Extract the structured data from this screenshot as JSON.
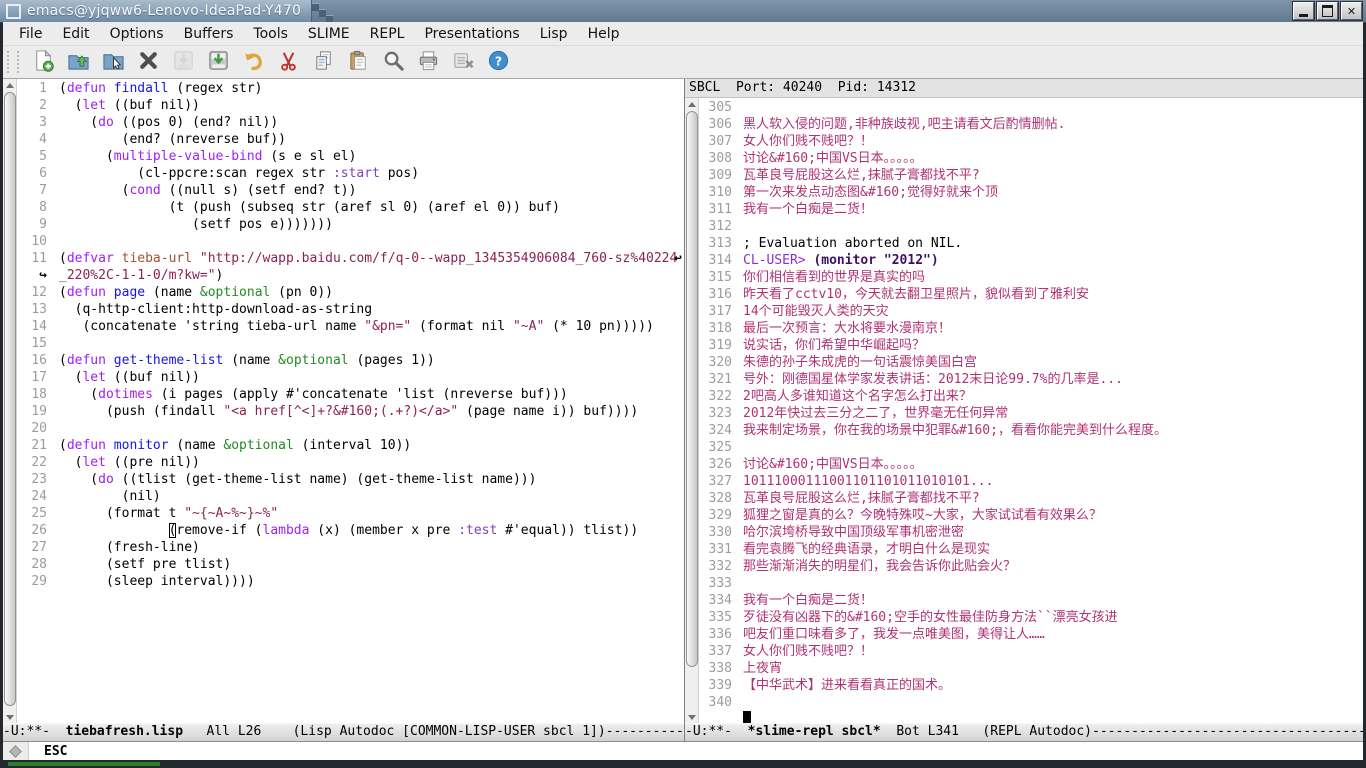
{
  "window": {
    "title": "emacs@yjqww6-Lenovo-IdeaPad-Y470",
    "buttons": [
      "minimize",
      "maximize",
      "close"
    ],
    "close_glyph": "✕"
  },
  "menu": {
    "items": [
      "File",
      "Edit",
      "Options",
      "Buffers",
      "Tools",
      "SLIME",
      "REPL",
      "Presentations",
      "Lisp",
      "Help"
    ]
  },
  "toolbar": {
    "buttons": [
      {
        "name": "new-file",
        "disabled": false
      },
      {
        "name": "open-file",
        "disabled": false
      },
      {
        "name": "dired",
        "disabled": false
      },
      {
        "name": "close-buffer",
        "disabled": false
      },
      {
        "name": "save",
        "disabled": true
      },
      {
        "name": "save-as",
        "disabled": false
      },
      {
        "name": "undo",
        "disabled": false
      },
      {
        "name": "cut",
        "disabled": false
      },
      {
        "name": "copy",
        "disabled": false
      },
      {
        "name": "paste",
        "disabled": false
      },
      {
        "name": "search",
        "disabled": false
      },
      {
        "name": "print",
        "disabled": false
      },
      {
        "name": "customize",
        "disabled": false
      },
      {
        "name": "help",
        "disabled": false
      }
    ]
  },
  "left_window": {
    "rows": [
      {
        "n": "1",
        "seg": [
          [
            "d",
            "("
          ],
          [
            "k",
            "defun"
          ],
          [
            "d",
            " "
          ],
          [
            "f",
            "findall"
          ],
          [
            "d",
            " (regex str)"
          ]
        ]
      },
      {
        "n": "2",
        "seg": [
          [
            "d",
            "  ("
          ],
          [
            "k",
            "let"
          ],
          [
            "d",
            " ((buf nil))"
          ]
        ]
      },
      {
        "n": "3",
        "seg": [
          [
            "d",
            "    ("
          ],
          [
            "k",
            "do"
          ],
          [
            "d",
            " ((pos 0) (end? nil))"
          ]
        ]
      },
      {
        "n": "4",
        "seg": [
          [
            "d",
            "        (end? (nreverse buf))"
          ]
        ]
      },
      {
        "n": "5",
        "seg": [
          [
            "d",
            "      ("
          ],
          [
            "k",
            "multiple-value-bind"
          ],
          [
            "d",
            " (s e sl el)"
          ]
        ]
      },
      {
        "n": "6",
        "seg": [
          [
            "d",
            "          (cl-ppcre:scan regex str "
          ],
          [
            "b",
            ":start"
          ],
          [
            "d",
            " pos)"
          ]
        ]
      },
      {
        "n": "7",
        "seg": [
          [
            "d",
            "        ("
          ],
          [
            "k",
            "cond"
          ],
          [
            "d",
            " ((null s) (setf end? t))"
          ]
        ]
      },
      {
        "n": "8",
        "seg": [
          [
            "d",
            "              (t (push (subseq str (aref sl 0) (aref el 0)) buf)"
          ]
        ]
      },
      {
        "n": "9",
        "seg": [
          [
            "d",
            "                 (setf pos e)))))))"
          ]
        ]
      },
      {
        "n": "10",
        "seg": []
      },
      {
        "n": "11",
        "wrapEnd": true,
        "seg": [
          [
            "d",
            "("
          ],
          [
            "k",
            "defvar"
          ],
          [
            "d",
            " "
          ],
          [
            "v",
            "tieba-url"
          ],
          [
            "d",
            " "
          ],
          [
            "s",
            "\"http://wapp.baidu.com/f/q-0--wapp_1345354906084_760-sz%40224"
          ]
        ]
      },
      {
        "n": "",
        "wrapStart": true,
        "seg": [
          [
            "s",
            "_220%2C-1-1-0/m?kw=\""
          ],
          [
            "d",
            ")"
          ]
        ]
      },
      {
        "n": "12",
        "seg": [
          [
            "d",
            "("
          ],
          [
            "k",
            "defun"
          ],
          [
            "d",
            " "
          ],
          [
            "f",
            "page"
          ],
          [
            "d",
            " (name "
          ],
          [
            "t",
            "&optional"
          ],
          [
            "d",
            " (pn 0))"
          ]
        ]
      },
      {
        "n": "13",
        "seg": [
          [
            "d",
            "  (q-http-client:http-download-as-string"
          ]
        ]
      },
      {
        "n": "14",
        "seg": [
          [
            "d",
            "   (concatenate 'string tieba-url name "
          ],
          [
            "s",
            "\"&pn=\""
          ],
          [
            "d",
            " (format nil "
          ],
          [
            "s",
            "\"~A\""
          ],
          [
            "d",
            " (* 10 pn)))))"
          ]
        ]
      },
      {
        "n": "15",
        "seg": []
      },
      {
        "n": "16",
        "seg": [
          [
            "d",
            "("
          ],
          [
            "k",
            "defun"
          ],
          [
            "d",
            " "
          ],
          [
            "f",
            "get-theme-list"
          ],
          [
            "d",
            " (name "
          ],
          [
            "t",
            "&optional"
          ],
          [
            "d",
            " (pages 1))"
          ]
        ]
      },
      {
        "n": "17",
        "seg": [
          [
            "d",
            "  ("
          ],
          [
            "k",
            "let"
          ],
          [
            "d",
            " ((buf nil))"
          ]
        ]
      },
      {
        "n": "18",
        "seg": [
          [
            "d",
            "    ("
          ],
          [
            "k",
            "dotimes"
          ],
          [
            "d",
            " (i pages (apply #'concatenate 'list (nreverse buf)))"
          ]
        ]
      },
      {
        "n": "19",
        "seg": [
          [
            "d",
            "      (push (findall "
          ],
          [
            "s",
            "\"<a href[^<]+?&#160;(.+?)</a>\""
          ],
          [
            "d",
            " (page name i)) buf))))"
          ]
        ]
      },
      {
        "n": "20",
        "seg": []
      },
      {
        "n": "21",
        "seg": [
          [
            "d",
            "("
          ],
          [
            "k",
            "defun"
          ],
          [
            "d",
            " "
          ],
          [
            "f",
            "monitor"
          ],
          [
            "d",
            " (name "
          ],
          [
            "t",
            "&optional"
          ],
          [
            "d",
            " (interval 10))"
          ]
        ]
      },
      {
        "n": "22",
        "seg": [
          [
            "d",
            "  ("
          ],
          [
            "k",
            "let"
          ],
          [
            "d",
            " ((pre nil))"
          ]
        ]
      },
      {
        "n": "23",
        "seg": [
          [
            "d",
            "    ("
          ],
          [
            "k",
            "do"
          ],
          [
            "d",
            " ((tlist (get-theme-list name) (get-theme-list name)))"
          ]
        ]
      },
      {
        "n": "24",
        "seg": [
          [
            "d",
            "        (nil)"
          ]
        ]
      },
      {
        "n": "25",
        "seg": [
          [
            "d",
            "      (format t "
          ],
          [
            "s",
            "\"~{~A~%~}~%\""
          ]
        ]
      },
      {
        "n": "26",
        "seg": [
          [
            "d",
            "              "
          ],
          [
            "cur",
            "("
          ],
          [
            "d",
            "remove-if ("
          ],
          [
            "k",
            "lambda"
          ],
          [
            "d",
            " (x) (member x pre "
          ],
          [
            "b",
            ":test"
          ],
          [
            "d",
            " #'equal)) tlist))"
          ]
        ]
      },
      {
        "n": "27",
        "seg": [
          [
            "d",
            "      (fresh-line)"
          ]
        ]
      },
      {
        "n": "28",
        "seg": [
          [
            "d",
            "      (setf pre tlist)"
          ]
        ]
      },
      {
        "n": "29",
        "seg": [
          [
            "d",
            "      (sleep interval))))"
          ]
        ]
      }
    ]
  },
  "right_window": {
    "header": "SBCL  Port: 40240  Pid: 14312",
    "rows": [
      {
        "n": "305",
        "seg": []
      },
      {
        "n": "306",
        "seg": [
          [
            "out",
            "黑人软入侵的问题,非种族歧视,吧主请看文后酌情删帖."
          ]
        ]
      },
      {
        "n": "307",
        "seg": [
          [
            "out",
            "女人你们贱不贱吧？！"
          ]
        ]
      },
      {
        "n": "308",
        "seg": [
          [
            "out",
            "讨论&#160;中国VS日本。。。。。"
          ]
        ]
      },
      {
        "n": "309",
        "seg": [
          [
            "out",
            "瓦革良号屁股这么烂,抹腻子膏都找不平?"
          ]
        ]
      },
      {
        "n": "310",
        "seg": [
          [
            "out",
            "第一次来发点动态图&#160;觉得好就来个顶"
          ]
        ]
      },
      {
        "n": "311",
        "seg": [
          [
            "out",
            "我有一个白痴是二货！"
          ]
        ]
      },
      {
        "n": "312",
        "seg": []
      },
      {
        "n": "313",
        "seg": [
          [
            "d",
            "; Evaluation aborted on NIL."
          ]
        ]
      },
      {
        "n": "314",
        "seg": [
          [
            "p",
            "CL-USER>"
          ],
          [
            "d",
            " "
          ],
          [
            "in",
            "(monitor \"2012\")"
          ]
        ]
      },
      {
        "n": "315",
        "seg": [
          [
            "out",
            "你们相信看到的世界是真实的吗"
          ]
        ]
      },
      {
        "n": "316",
        "seg": [
          [
            "out",
            "昨天看了cctv10，今天就去翻卫星照片，貌似看到了雅利安"
          ]
        ]
      },
      {
        "n": "317",
        "seg": [
          [
            "out",
            "14个可能毁灭人类的天灾"
          ]
        ]
      },
      {
        "n": "318",
        "seg": [
          [
            "out",
            "最后一次预言：大水将要水漫南京！"
          ]
        ]
      },
      {
        "n": "319",
        "seg": [
          [
            "out",
            "说实话，你们希望中华崛起吗？"
          ]
        ]
      },
      {
        "n": "320",
        "seg": [
          [
            "out",
            "朱德的孙子朱成虎的一句话震惊美国白宫"
          ]
        ]
      },
      {
        "n": "321",
        "seg": [
          [
            "out",
            "号外：刚德国星体学家发表讲话：2012末日论99.7%的几率是..."
          ]
        ]
      },
      {
        "n": "322",
        "seg": [
          [
            "out",
            "2吧高人多谁知道这个名字怎么打出来？"
          ]
        ]
      },
      {
        "n": "323",
        "seg": [
          [
            "out",
            "2012年快过去三分之二了，世界毫无任何异常"
          ]
        ]
      },
      {
        "n": "324",
        "seg": [
          [
            "out",
            "我来制定场景，你在我的场景中犯罪&#160;，看看你能完美到什么程度。"
          ]
        ]
      },
      {
        "n": "325",
        "seg": []
      },
      {
        "n": "326",
        "seg": [
          [
            "out",
            "讨论&#160;中国VS日本。。。。。"
          ]
        ]
      },
      {
        "n": "327",
        "seg": [
          [
            "out",
            "10111000111001101101011010101..."
          ]
        ]
      },
      {
        "n": "328",
        "seg": [
          [
            "out",
            "瓦革良号屁股这么烂,抹腻子膏都找不平?"
          ]
        ]
      },
      {
        "n": "329",
        "seg": [
          [
            "out",
            "狐狸之窗是真的么？今晚特殊哎~大家，大家试试看有效果么？"
          ]
        ]
      },
      {
        "n": "330",
        "seg": [
          [
            "out",
            "哈尔滨垮桥导致中国顶级军事机密泄密"
          ]
        ]
      },
      {
        "n": "331",
        "seg": [
          [
            "out",
            "看完袁腾飞的经典语录，才明白什么是现实"
          ]
        ]
      },
      {
        "n": "332",
        "seg": [
          [
            "out",
            "那些渐渐消失的明星们，我会告诉你此贴会火？"
          ]
        ]
      },
      {
        "n": "333",
        "seg": []
      },
      {
        "n": "334",
        "seg": [
          [
            "out",
            "我有一个白痴是二货！"
          ]
        ]
      },
      {
        "n": "335",
        "seg": [
          [
            "out",
            "歹徒没有凶器下的&#160;空手的女性最佳防身方法``漂亮女孩进"
          ]
        ]
      },
      {
        "n": "336",
        "seg": [
          [
            "out",
            "吧友们重口味看多了，我发一点唯美图，美得让人……"
          ]
        ]
      },
      {
        "n": "337",
        "seg": [
          [
            "out",
            "女人你们贱不贱吧？！"
          ]
        ]
      },
      {
        "n": "338",
        "seg": [
          [
            "out",
            "上夜宵"
          ]
        ]
      },
      {
        "n": "339",
        "seg": [
          [
            "out",
            "【中华武术】进来看看真正的国术。"
          ]
        ]
      },
      {
        "n": "340",
        "seg": []
      },
      {
        "n": "",
        "cursor": true,
        "seg": []
      }
    ]
  },
  "left_modeline": {
    "prefix": "-U:**-  ",
    "buffer": "tiebafresh.lisp",
    "suffix": "   All L26    (Lisp Autodoc [COMMON-LISP-USER sbcl 1])",
    "dashes": "--------------------------------------------------------------------------------"
  },
  "right_modeline": {
    "prefix": "-U:**-  ",
    "buffer": "*slime-repl sbcl*",
    "suffix": "  Bot L341   (REPL Autodoc)",
    "dashes": "--------------------------------------------------------------------------------"
  },
  "minibuffer": {
    "text": "ESC"
  },
  "colors": {
    "keyword": "#a020f0",
    "function_name": "#1515e6",
    "string": "#8b2252",
    "variable_name": "#a0522d",
    "type": "#228b22",
    "builtin": "#7d3fc4",
    "repl_output": "#b03273",
    "repl_prompt": "#8b2fd6",
    "repl_input": "#3a1166",
    "titlebar": "#7e95ac",
    "chrome_bg": "#ececec"
  }
}
